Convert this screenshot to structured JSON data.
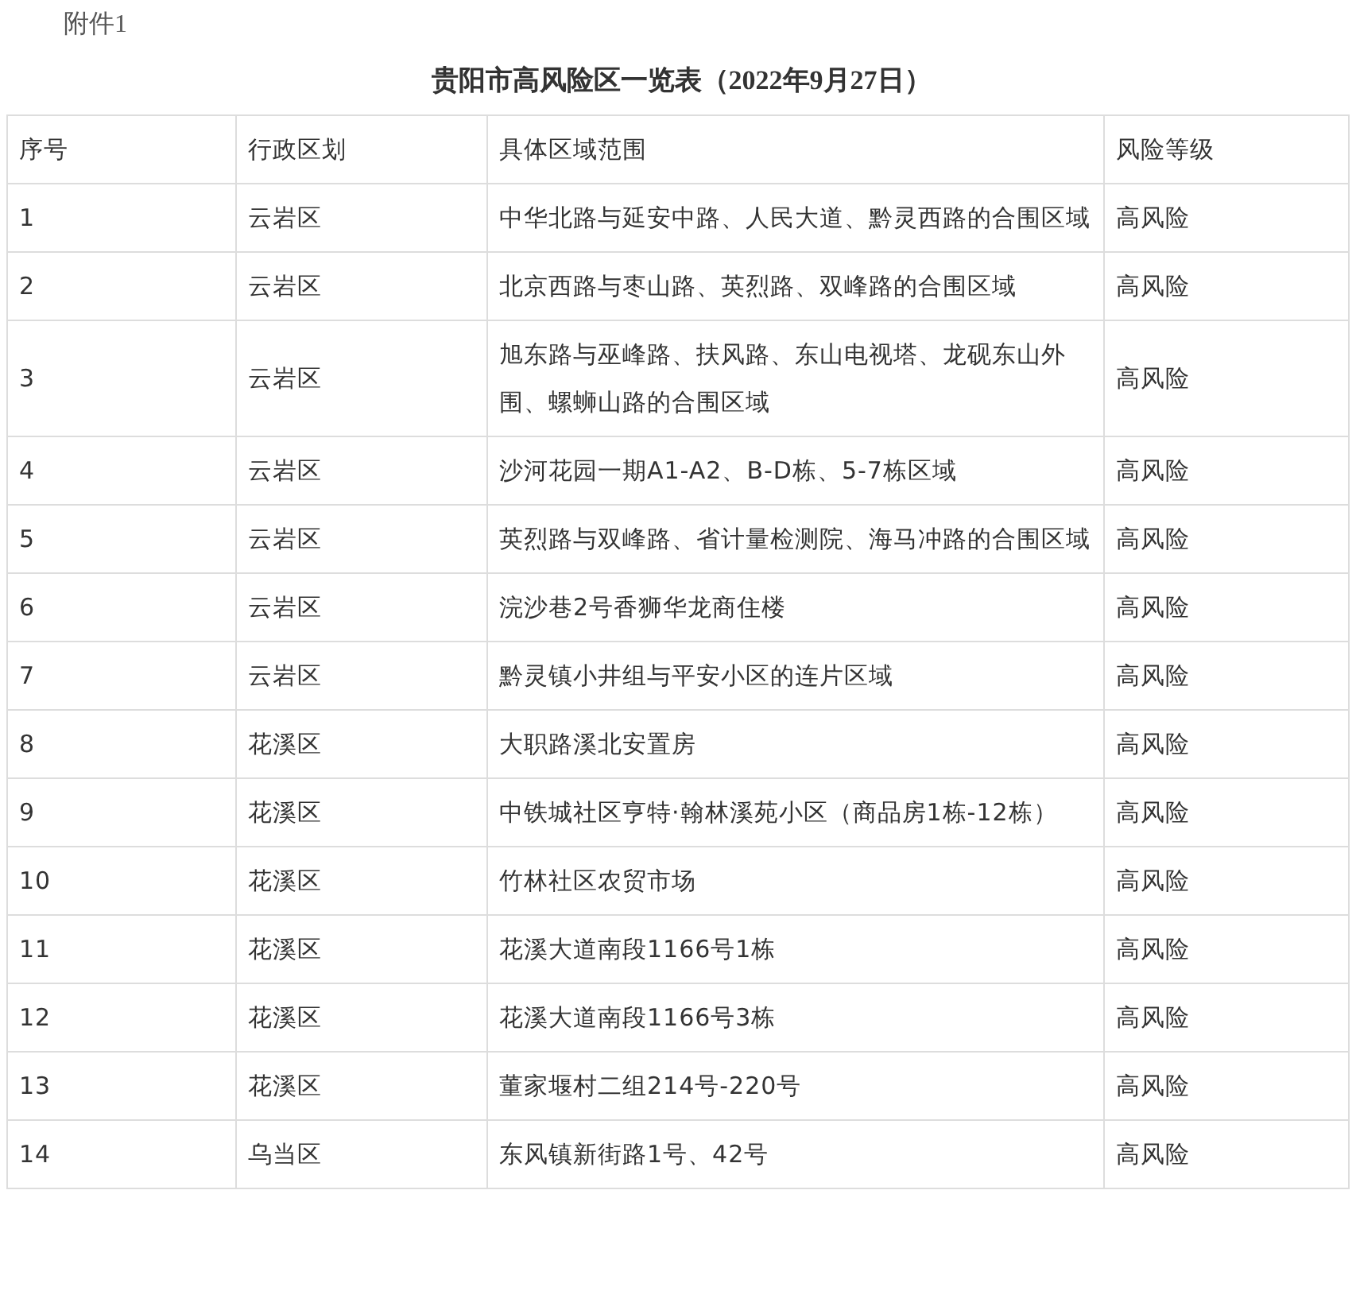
{
  "attachment_label": "附件1",
  "title": "贵阳市高风险区一览表（2022年9月27日）",
  "table": {
    "columns": [
      "序号",
      "行政区划",
      "具体区域范围",
      "风险等级"
    ],
    "rows": [
      [
        "1",
        "云岩区",
        "中华北路与延安中路、人民大道、黔灵西路的合围区域",
        "高风险"
      ],
      [
        "2",
        "云岩区",
        "北京西路与枣山路、英烈路、双峰路的合围区域",
        "高风险"
      ],
      [
        "3",
        "云岩区",
        "旭东路与巫峰路、扶风路、东山电视塔、龙砚东山外围、螺蛳山路的合围区域",
        "高风险"
      ],
      [
        "4",
        "云岩区",
        "沙河花园一期A1-A2、B-D栋、5-7栋区域",
        "高风险"
      ],
      [
        "5",
        "云岩区",
        "英烈路与双峰路、省计量检测院、海马冲路的合围区域",
        "高风险"
      ],
      [
        "6",
        "云岩区",
        "浣沙巷2号香狮华龙商住楼",
        "高风险"
      ],
      [
        "7",
        "云岩区",
        "黔灵镇小井组与平安小区的连片区域",
        "高风险"
      ],
      [
        "8",
        "花溪区",
        "大职路溪北安置房",
        "高风险"
      ],
      [
        "9",
        "花溪区",
        "中铁城社区亨特·翰林溪苑小区（商品房1栋-12栋）",
        "高风险"
      ],
      [
        "10",
        "花溪区",
        "竹林社区农贸市场",
        "高风险"
      ],
      [
        "11",
        "花溪区",
        "花溪大道南段1166号1栋",
        "高风险"
      ],
      [
        "12",
        "花溪区",
        "花溪大道南段1166号3栋",
        "高风险"
      ],
      [
        "13",
        "花溪区",
        "董家堰村二组214号-220号",
        "高风险"
      ],
      [
        "14",
        "乌当区",
        "东风镇新街路1号、42号",
        "高风险"
      ]
    ]
  }
}
